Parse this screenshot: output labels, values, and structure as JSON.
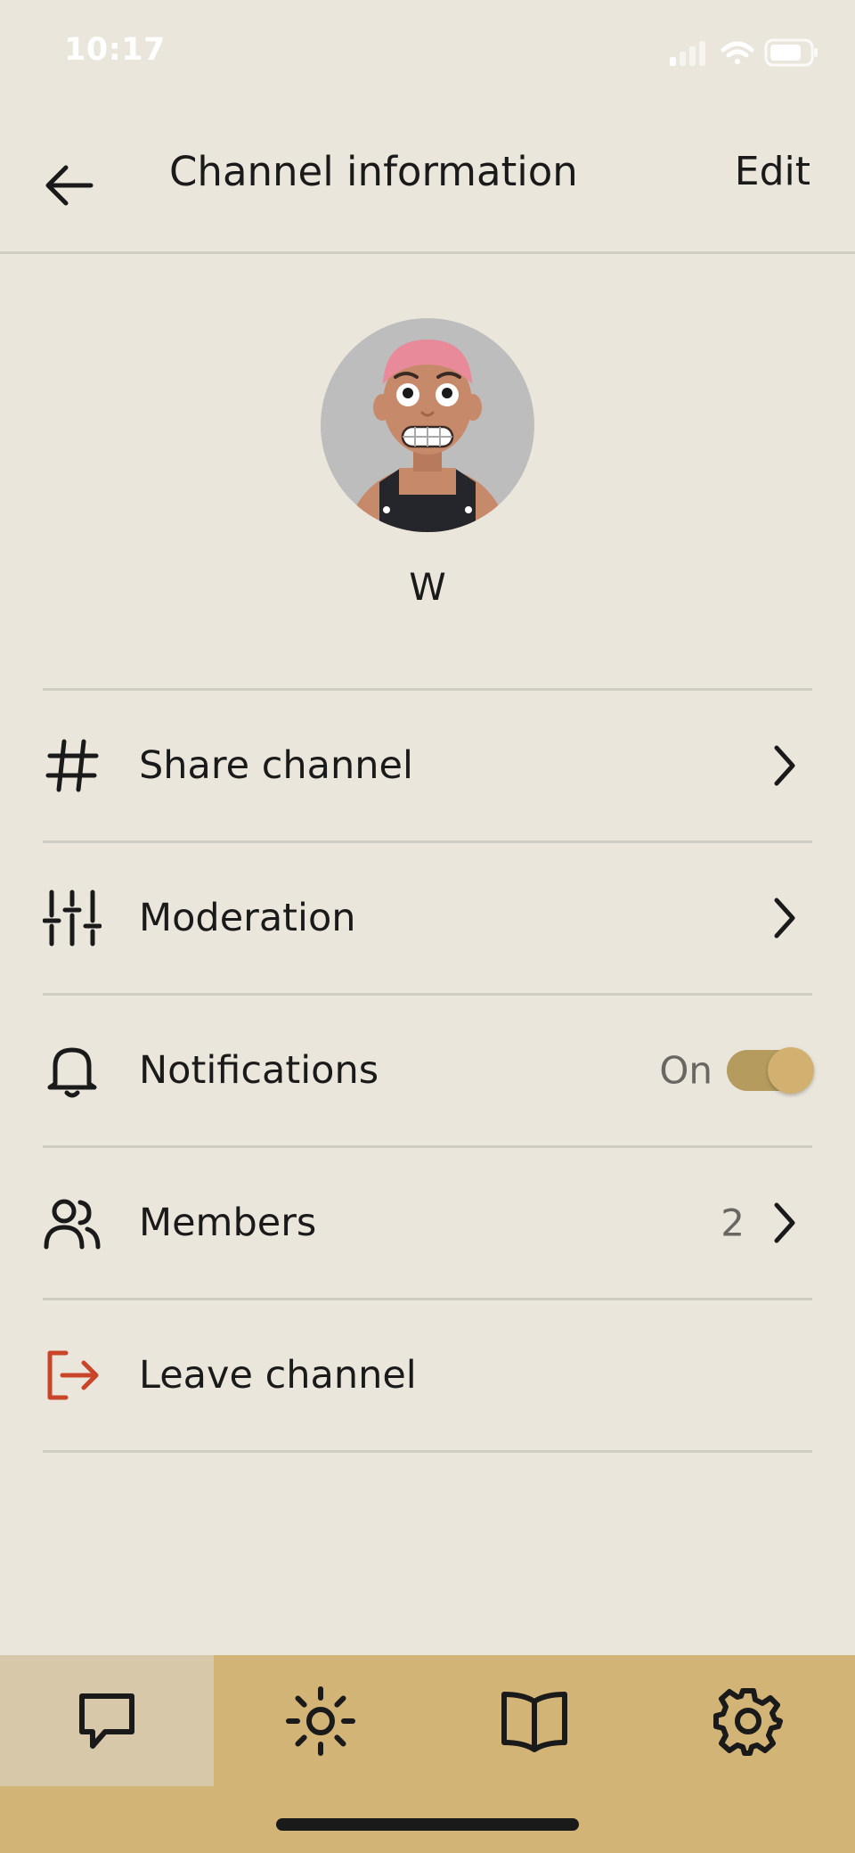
{
  "status_bar": {
    "time": "10:17"
  },
  "header": {
    "title": "Channel information",
    "edit_label": "Edit"
  },
  "channel": {
    "name": "W"
  },
  "menu": {
    "share": {
      "label": "Share channel",
      "icon": "hash-icon"
    },
    "moderation": {
      "label": "Moderation",
      "icon": "sliders-icon"
    },
    "notifications": {
      "label": "Notifications",
      "value": "On",
      "icon": "bell-icon",
      "enabled": true
    },
    "members": {
      "label": "Members",
      "count": "2",
      "icon": "users-icon"
    },
    "leave": {
      "label": "Leave channel",
      "icon": "logout-icon",
      "color": "#c8452a"
    }
  },
  "tabbar": {
    "tabs": [
      {
        "name": "chat",
        "icon": "chat-bubble-icon",
        "active": true
      },
      {
        "name": "brightness",
        "icon": "sun-icon",
        "active": false
      },
      {
        "name": "library",
        "icon": "book-icon",
        "active": false
      },
      {
        "name": "settings",
        "icon": "gear-icon",
        "active": false
      }
    ]
  },
  "colors": {
    "background": "#ebe6dc",
    "accent": "#d2b477",
    "toggle_on": "#b59c5e",
    "divider": "#cfccc4",
    "danger": "#c8452a"
  }
}
